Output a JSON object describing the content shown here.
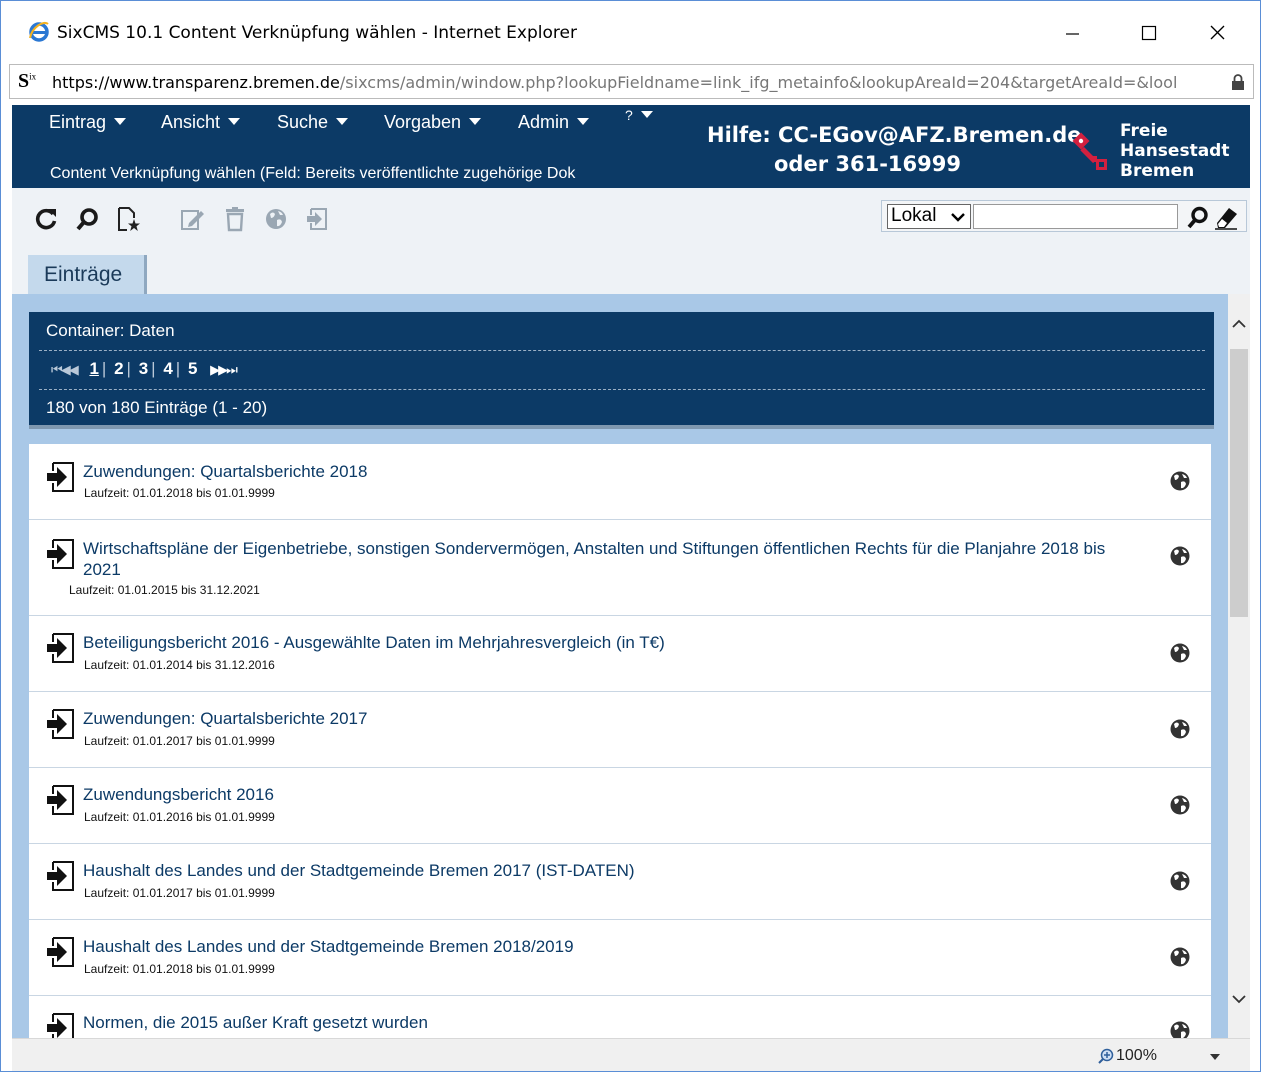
{
  "window": {
    "title": "SixCMS 10.1 Content Verknüpfung wählen - Internet Explorer"
  },
  "address": {
    "prefix": "https://www.transparenz.",
    "domain": "bremen.de",
    "path": "/sixcms/admin/window.php?lookupFieldname=link_ifg_metainfo&lookupAreaId=204&targetAreaId=&lool"
  },
  "menu": {
    "items": [
      "Eintrag",
      "Ansicht",
      "Suche",
      "Vorgaben",
      "Admin",
      "?"
    ]
  },
  "header": {
    "subtitle": "Content Verknüpfung wählen (Feld: Bereits veröffentlichte zugehörige Dok",
    "help_line1": "Hilfe: CC-EGov@AFZ.Bremen.de",
    "help_line2": "oder 361-16999",
    "brand": [
      "Freie",
      "Hansestadt",
      "Bremen"
    ]
  },
  "search": {
    "scope": "Lokal",
    "query": ""
  },
  "tabs": [
    "Einträge"
  ],
  "container": {
    "title": "Container: Daten",
    "pager": {
      "first_prev": "⏮◀◀",
      "pages": [
        "1",
        "2",
        "3",
        "4",
        "5"
      ],
      "current": "1",
      "next_last": "▶▶⏭"
    },
    "count": "180 von 180 Einträge (1 - 20)"
  },
  "entries": [
    {
      "title": "Zuwendungen: Quartalsberichte 2018",
      "meta": "Laufzeit: 01.01.2018 bis 01.01.9999"
    },
    {
      "title": "Wirtschaftspläne der Eigenbetriebe, sonstigen Sondervermögen, Anstalten und Stiftungen öffentlichen Rechts für die Planjahre 2018 bis 2021",
      "meta": "Laufzeit: 01.01.2015 bis 31.12.2021"
    },
    {
      "title": "Beteiligungsbericht 2016 - Ausgewählte Daten im Mehrjahresvergleich (in T€)",
      "meta": "Laufzeit: 01.01.2014 bis 31.12.2016"
    },
    {
      "title": "Zuwendungen: Quartalsberichte 2017",
      "meta": "Laufzeit: 01.01.2017 bis 01.01.9999"
    },
    {
      "title": "Zuwendungsbericht 2016",
      "meta": "Laufzeit: 01.01.2016 bis 01.01.9999"
    },
    {
      "title": "Haushalt des Landes und der Stadtgemeinde Bremen 2017 (IST-DATEN)",
      "meta": "Laufzeit: 01.01.2017 bis 01.01.9999"
    },
    {
      "title": "Haushalt des Landes und der Stadtgemeinde Bremen 2018/2019",
      "meta": "Laufzeit: 01.01.2018 bis 01.01.9999"
    },
    {
      "title": "Normen, die 2015 außer Kraft gesetzt wurden",
      "meta": ""
    }
  ],
  "status": {
    "zoom": "100%"
  },
  "colors": {
    "header_bg": "#0c3a66",
    "content_bg": "#a9c8e7",
    "link": "#0c3a66",
    "brand_red": "#d3203f"
  }
}
